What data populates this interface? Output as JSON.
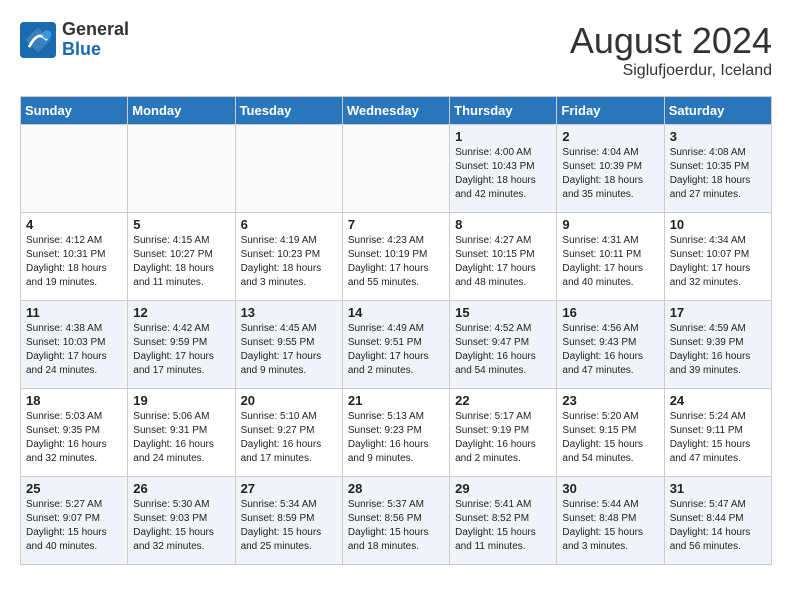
{
  "header": {
    "logo_line1": "General",
    "logo_line2": "Blue",
    "month": "August 2024",
    "location": "Siglufjoerdur, Iceland"
  },
  "weekdays": [
    "Sunday",
    "Monday",
    "Tuesday",
    "Wednesday",
    "Thursday",
    "Friday",
    "Saturday"
  ],
  "weeks": [
    [
      {
        "day": "",
        "info": ""
      },
      {
        "day": "",
        "info": ""
      },
      {
        "day": "",
        "info": ""
      },
      {
        "day": "",
        "info": ""
      },
      {
        "day": "1",
        "info": "Sunrise: 4:00 AM\nSunset: 10:43 PM\nDaylight: 18 hours\nand 42 minutes."
      },
      {
        "day": "2",
        "info": "Sunrise: 4:04 AM\nSunset: 10:39 PM\nDaylight: 18 hours\nand 35 minutes."
      },
      {
        "day": "3",
        "info": "Sunrise: 4:08 AM\nSunset: 10:35 PM\nDaylight: 18 hours\nand 27 minutes."
      }
    ],
    [
      {
        "day": "4",
        "info": "Sunrise: 4:12 AM\nSunset: 10:31 PM\nDaylight: 18 hours\nand 19 minutes."
      },
      {
        "day": "5",
        "info": "Sunrise: 4:15 AM\nSunset: 10:27 PM\nDaylight: 18 hours\nand 11 minutes."
      },
      {
        "day": "6",
        "info": "Sunrise: 4:19 AM\nSunset: 10:23 PM\nDaylight: 18 hours\nand 3 minutes."
      },
      {
        "day": "7",
        "info": "Sunrise: 4:23 AM\nSunset: 10:19 PM\nDaylight: 17 hours\nand 55 minutes."
      },
      {
        "day": "8",
        "info": "Sunrise: 4:27 AM\nSunset: 10:15 PM\nDaylight: 17 hours\nand 48 minutes."
      },
      {
        "day": "9",
        "info": "Sunrise: 4:31 AM\nSunset: 10:11 PM\nDaylight: 17 hours\nand 40 minutes."
      },
      {
        "day": "10",
        "info": "Sunrise: 4:34 AM\nSunset: 10:07 PM\nDaylight: 17 hours\nand 32 minutes."
      }
    ],
    [
      {
        "day": "11",
        "info": "Sunrise: 4:38 AM\nSunset: 10:03 PM\nDaylight: 17 hours\nand 24 minutes."
      },
      {
        "day": "12",
        "info": "Sunrise: 4:42 AM\nSunset: 9:59 PM\nDaylight: 17 hours\nand 17 minutes."
      },
      {
        "day": "13",
        "info": "Sunrise: 4:45 AM\nSunset: 9:55 PM\nDaylight: 17 hours\nand 9 minutes."
      },
      {
        "day": "14",
        "info": "Sunrise: 4:49 AM\nSunset: 9:51 PM\nDaylight: 17 hours\nand 2 minutes."
      },
      {
        "day": "15",
        "info": "Sunrise: 4:52 AM\nSunset: 9:47 PM\nDaylight: 16 hours\nand 54 minutes."
      },
      {
        "day": "16",
        "info": "Sunrise: 4:56 AM\nSunset: 9:43 PM\nDaylight: 16 hours\nand 47 minutes."
      },
      {
        "day": "17",
        "info": "Sunrise: 4:59 AM\nSunset: 9:39 PM\nDaylight: 16 hours\nand 39 minutes."
      }
    ],
    [
      {
        "day": "18",
        "info": "Sunrise: 5:03 AM\nSunset: 9:35 PM\nDaylight: 16 hours\nand 32 minutes."
      },
      {
        "day": "19",
        "info": "Sunrise: 5:06 AM\nSunset: 9:31 PM\nDaylight: 16 hours\nand 24 minutes."
      },
      {
        "day": "20",
        "info": "Sunrise: 5:10 AM\nSunset: 9:27 PM\nDaylight: 16 hours\nand 17 minutes."
      },
      {
        "day": "21",
        "info": "Sunrise: 5:13 AM\nSunset: 9:23 PM\nDaylight: 16 hours\nand 9 minutes."
      },
      {
        "day": "22",
        "info": "Sunrise: 5:17 AM\nSunset: 9:19 PM\nDaylight: 16 hours\nand 2 minutes."
      },
      {
        "day": "23",
        "info": "Sunrise: 5:20 AM\nSunset: 9:15 PM\nDaylight: 15 hours\nand 54 minutes."
      },
      {
        "day": "24",
        "info": "Sunrise: 5:24 AM\nSunset: 9:11 PM\nDaylight: 15 hours\nand 47 minutes."
      }
    ],
    [
      {
        "day": "25",
        "info": "Sunrise: 5:27 AM\nSunset: 9:07 PM\nDaylight: 15 hours\nand 40 minutes."
      },
      {
        "day": "26",
        "info": "Sunrise: 5:30 AM\nSunset: 9:03 PM\nDaylight: 15 hours\nand 32 minutes."
      },
      {
        "day": "27",
        "info": "Sunrise: 5:34 AM\nSunset: 8:59 PM\nDaylight: 15 hours\nand 25 minutes."
      },
      {
        "day": "28",
        "info": "Sunrise: 5:37 AM\nSunset: 8:56 PM\nDaylight: 15 hours\nand 18 minutes."
      },
      {
        "day": "29",
        "info": "Sunrise: 5:41 AM\nSunset: 8:52 PM\nDaylight: 15 hours\nand 11 minutes."
      },
      {
        "day": "30",
        "info": "Sunrise: 5:44 AM\nSunset: 8:48 PM\nDaylight: 15 hours\nand 3 minutes."
      },
      {
        "day": "31",
        "info": "Sunrise: 5:47 AM\nSunset: 8:44 PM\nDaylight: 14 hours\nand 56 minutes."
      }
    ]
  ]
}
